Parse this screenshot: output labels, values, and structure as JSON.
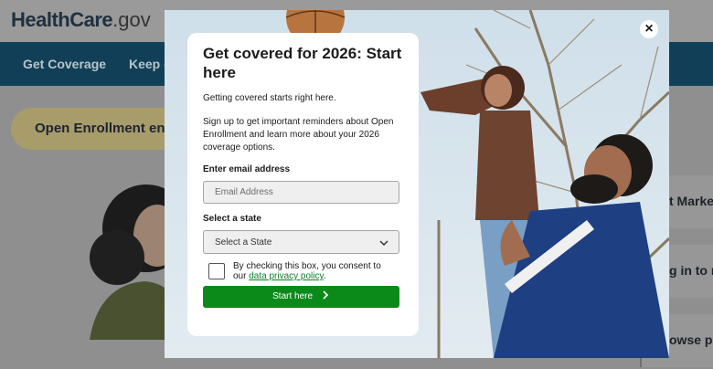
{
  "background": {
    "logo": {
      "part1": "HealthCare",
      "part2": ".gov"
    },
    "nav": [
      {
        "label": "Get Coverage"
      },
      {
        "label": "Keep c"
      }
    ],
    "enrollment_banner": "Open Enrollment end",
    "side_links": [
      {
        "label": "t Marke"
      },
      {
        "label": "g in to m"
      },
      {
        "label": "owse pl"
      }
    ]
  },
  "modal": {
    "close_label": "×",
    "title": "Get covered for 2026: Start here",
    "intro": "Getting covered starts right here.",
    "body": "Sign up to get important reminders about Open Enrollment and learn more about your 2026 coverage options.",
    "email": {
      "label": "Enter email address",
      "placeholder": "Email Address",
      "value": ""
    },
    "state": {
      "label": "Select a state",
      "selected": "Select a State"
    },
    "consent": {
      "text": "By checking this box, you consent to our",
      "link": "data privacy policy",
      "after": ".",
      "checked": false
    },
    "submit_label": "Start here"
  },
  "icons": {
    "close": "close-icon",
    "chevron": "chevron-down-icon",
    "arrow": "chevron-right-icon"
  },
  "colors": {
    "primary_green": "#0b8a1a",
    "link_green": "#0f7a2c",
    "nav_bg": "#113f57"
  }
}
